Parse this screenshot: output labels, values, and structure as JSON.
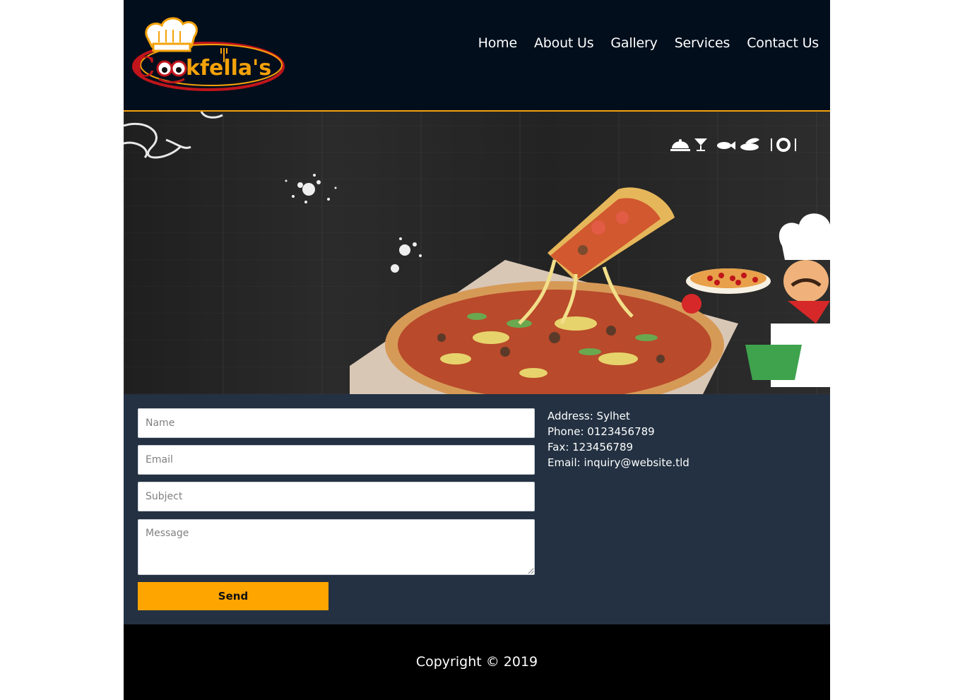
{
  "brand": {
    "logo_text": "Cookfella's",
    "colors": {
      "orange": "#f4a20a",
      "red": "#c0151b",
      "header_bg": "#020e1c",
      "contact_bg": "#233142",
      "button": "#ffa500"
    }
  },
  "nav": {
    "items": [
      {
        "label": "Home"
      },
      {
        "label": "About Us"
      },
      {
        "label": "Gallery"
      },
      {
        "label": "Services"
      },
      {
        "label": "Contact Us"
      }
    ]
  },
  "hero": {
    "icons": [
      "cloche-icon",
      "cocktail-icon",
      "fish-icon",
      "leaf-dish-icon",
      "cutlery-plate-icon"
    ]
  },
  "form": {
    "name_placeholder": "Name",
    "email_placeholder": "Email",
    "subject_placeholder": "Subject",
    "message_placeholder": "Message",
    "send_label": "Send"
  },
  "info": {
    "address": "Address: Sylhet",
    "phone": "Phone: 0123456789",
    "fax": "Fax: 123456789",
    "email": "Email: inquiry@website.tld"
  },
  "footer": {
    "copyright": "Copyright © 2019"
  }
}
